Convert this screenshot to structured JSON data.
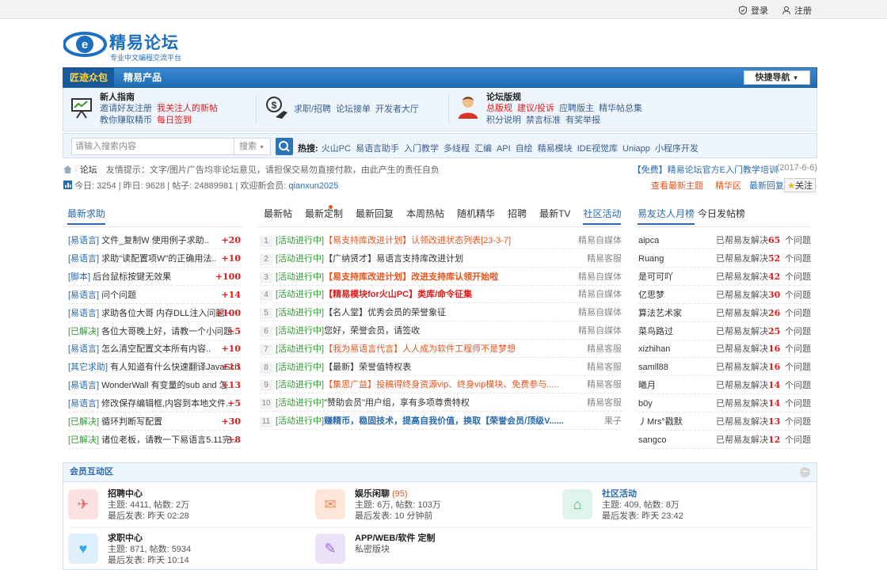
{
  "topbar": {
    "login": "登录",
    "register": "注册"
  },
  "logo": {
    "name": "精易论坛",
    "slogan": "专业中文编程交流平台"
  },
  "nav": {
    "tab_active": "匠迹众包",
    "tab2": "精易产品",
    "quick": "快捷导航"
  },
  "guide": {
    "s1": {
      "title": "新人指南",
      "links": [
        [
          "邀请好友注册",
          "我关注人的新帖"
        ],
        [
          "教你赚取精币",
          "每日签到"
        ]
      ]
    },
    "s2": {
      "links": [
        "求职/招聘",
        "论坛接单",
        "开发者大厅"
      ]
    },
    "s3": {
      "title": "论坛版规",
      "links": [
        [
          "总版规",
          "建议/投诉",
          "应聘版主",
          "精华帖总集"
        ],
        [
          "积分说明",
          "禁言标准",
          "有奖举报"
        ]
      ]
    }
  },
  "search": {
    "placeholder": "请输入搜索内容",
    "type": "搜索",
    "hot_label": "热搜:",
    "hot": [
      "火山PC",
      "易语言助手",
      "入门教学",
      "多线程",
      "汇编",
      "API",
      "自绘",
      "精易模块",
      "IDE视觉库",
      "Uniapp",
      "小程序开发"
    ]
  },
  "breadcrumb": {
    "home": "论坛",
    "notice": "友情提示：文字/图片广告均非论坛意见，请担保交易勿直接付款，由此产生的责任自负",
    "ad": "【免费】精易论坛官方E入门教学培训",
    "ad_date": "(2017-6-6)"
  },
  "stats": {
    "today": "今日: 3254",
    "yesterday": "昨日: 9628",
    "posts": "帖子: 24889981",
    "welcome": "欢迎新会员:",
    "new_member": "qianxun2025",
    "links": [
      "查看最新主题",
      "精华区",
      "最新回复"
    ],
    "follow": "关注"
  },
  "left": {
    "title": "最新求助",
    "rows": [
      {
        "tag": "[易语言]",
        "text": "文件_复制W 使用例子求助..",
        "num": "+20"
      },
      {
        "tag": "[易语言]",
        "text": "求助\"读配置项W\"的正确用法..",
        "num": "+10"
      },
      {
        "tag": "[脚本]",
        "text": "后台鼠标按键无效果",
        "num": "+100"
      },
      {
        "tag": "[易语言]",
        "text": "问个问题",
        "num": "+14"
      },
      {
        "tag": "[易语言]",
        "text": "求助各位大哥 内存DLL注入问题~..",
        "num": "+100"
      },
      {
        "tag": "[已解决]",
        "text": "各位大哥晚上好，请教一个小问题..",
        "num": "+5",
        "solved": true
      },
      {
        "tag": "[易语言]",
        "text": "怎么清空配置文本所有内容..",
        "num": "+10"
      },
      {
        "tag": "[其它求助]",
        "text": "有人知道有什么快速翻译JavaScri..",
        "num": "+13"
      },
      {
        "tag": "[易语言]",
        "text": "WonderWall 有变量的sub and 怎..",
        "num": "+13"
      },
      {
        "tag": "[易语言]",
        "text": "修改保存编辑框,内容到本地文件..",
        "num": "+5"
      },
      {
        "tag": "[已解决]",
        "text": "循环判断写配置",
        "num": "+30",
        "solved": true
      },
      {
        "tag": "[已解决]",
        "text": "诸位老板，请教一下易语言5.11完..",
        "num": "+8",
        "solved": true
      }
    ]
  },
  "mid": {
    "tabs": [
      "最新帖",
      "最新定制",
      "最新回复",
      "本周热帖",
      "随机精华",
      "招聘",
      "最新TV",
      "社区活动"
    ],
    "active": "社区活动",
    "rows": [
      {
        "n": "1",
        "tag": "[活动进行中]",
        "text": "【易支持库改进计划】认领改进状态列表[23-3-7]",
        "author": "精易自媒体",
        "style": "orange"
      },
      {
        "n": "2",
        "tag": "[活动进行中]",
        "text": "【广纳贤才】易语言支持库改进计划",
        "author": "精易客服",
        "style": "normal"
      },
      {
        "n": "3",
        "tag": "[活动进行中]",
        "text": "【易支持库改进计划】改进支持库认领开始啦",
        "author": "精易自媒体",
        "style": "orangeb"
      },
      {
        "n": "4",
        "tag": "[活动进行中]",
        "text": "【精易模块for火山PC】类库/命令征集",
        "author": "精易自媒体",
        "style": "redb"
      },
      {
        "n": "5",
        "tag": "[活动进行中]",
        "text": "【名人堂】优秀会员的荣誉象征",
        "author": "精易自媒体",
        "style": "normal"
      },
      {
        "n": "6",
        "tag": "[活动进行中]",
        "text": "您好，荣誉会员，请签收",
        "author": "精易自媒体",
        "style": "normal"
      },
      {
        "n": "7",
        "tag": "[活动进行中]",
        "text": "【我为易语言代言】人人成为软件工程师不是梦想",
        "author": "精易客服",
        "style": "orange"
      },
      {
        "n": "8",
        "tag": "[活动进行中]",
        "text": "【最新】荣誉值特权表",
        "author": "精易客服",
        "style": "normal"
      },
      {
        "n": "9",
        "tag": "[活动进行中]",
        "text": "【集思广益】投稿得终身资源vip、终身vip模块、免费参与.....",
        "author": "精易客服",
        "style": "orange"
      },
      {
        "n": "10",
        "tag": "[活动进行中]",
        "text": "\"赞助会员\"用户组，享有多项尊贵特权",
        "author": "精易客服",
        "style": "normal"
      },
      {
        "n": "11",
        "tag": "[活动进行中]",
        "text": "赚精币，稳固技术，提高自我价值，换取【荣誉会员/顶级V......",
        "author": "果子",
        "style": "blueb"
      }
    ]
  },
  "right": {
    "tabs": [
      "易友达人月榜",
      "今日发帖榜"
    ],
    "solved_label": "已帮易友解决",
    "unit": "个问题",
    "rows": [
      {
        "name": "aipca",
        "count": "65"
      },
      {
        "name": "Ruang",
        "count": "52"
      },
      {
        "name": "是可可吖",
        "count": "42"
      },
      {
        "name": "亿思梦",
        "count": "30"
      },
      {
        "name": "算法艺术家",
        "count": "26"
      },
      {
        "name": "菜鸟路过",
        "count": "25"
      },
      {
        "name": "xizhihan",
        "count": "16"
      },
      {
        "name": "samll88",
        "count": "16"
      },
      {
        "name": "曦月",
        "count": "14"
      },
      {
        "name": "b0y",
        "count": "14"
      },
      {
        "name": "丿Mrs°戳默",
        "count": "13"
      },
      {
        "name": "sangco",
        "count": "12"
      }
    ]
  },
  "members": {
    "title": "会员互动区",
    "forums": [
      {
        "name": "招聘中心",
        "l1": "主题: 4411, 帖数: 2万",
        "l2": "最后发表: 昨天 02:28",
        "color": "#fbe1e1",
        "icolor": "#e86a6a"
      },
      {
        "name": "娱乐闲聊",
        "extra": "(95)",
        "l1": "主题: 6万, 帖数: 103万",
        "l2": "最后发表: 10 分钟前",
        "color": "#fde6d8",
        "icolor": "#ef8a52"
      },
      {
        "name": "社区活动",
        "l1": "主题: 409, 帖数: 8万",
        "l2": "最后发表: 昨天 23:42",
        "color": "#dff4ea",
        "icolor": "#3cbc7a",
        "link": true
      },
      {
        "name": "求职中心",
        "l1": "主题: 871, 帖数: 5934",
        "l2": "最后发表: 昨天 10:14",
        "color": "#ddf0fb",
        "icolor": "#39a6e0"
      },
      {
        "name": "APP/WEB/软件 定制",
        "l1": "私密版块",
        "l2": "",
        "color": "#ece2f7",
        "icolor": "#9a69d6"
      }
    ]
  }
}
